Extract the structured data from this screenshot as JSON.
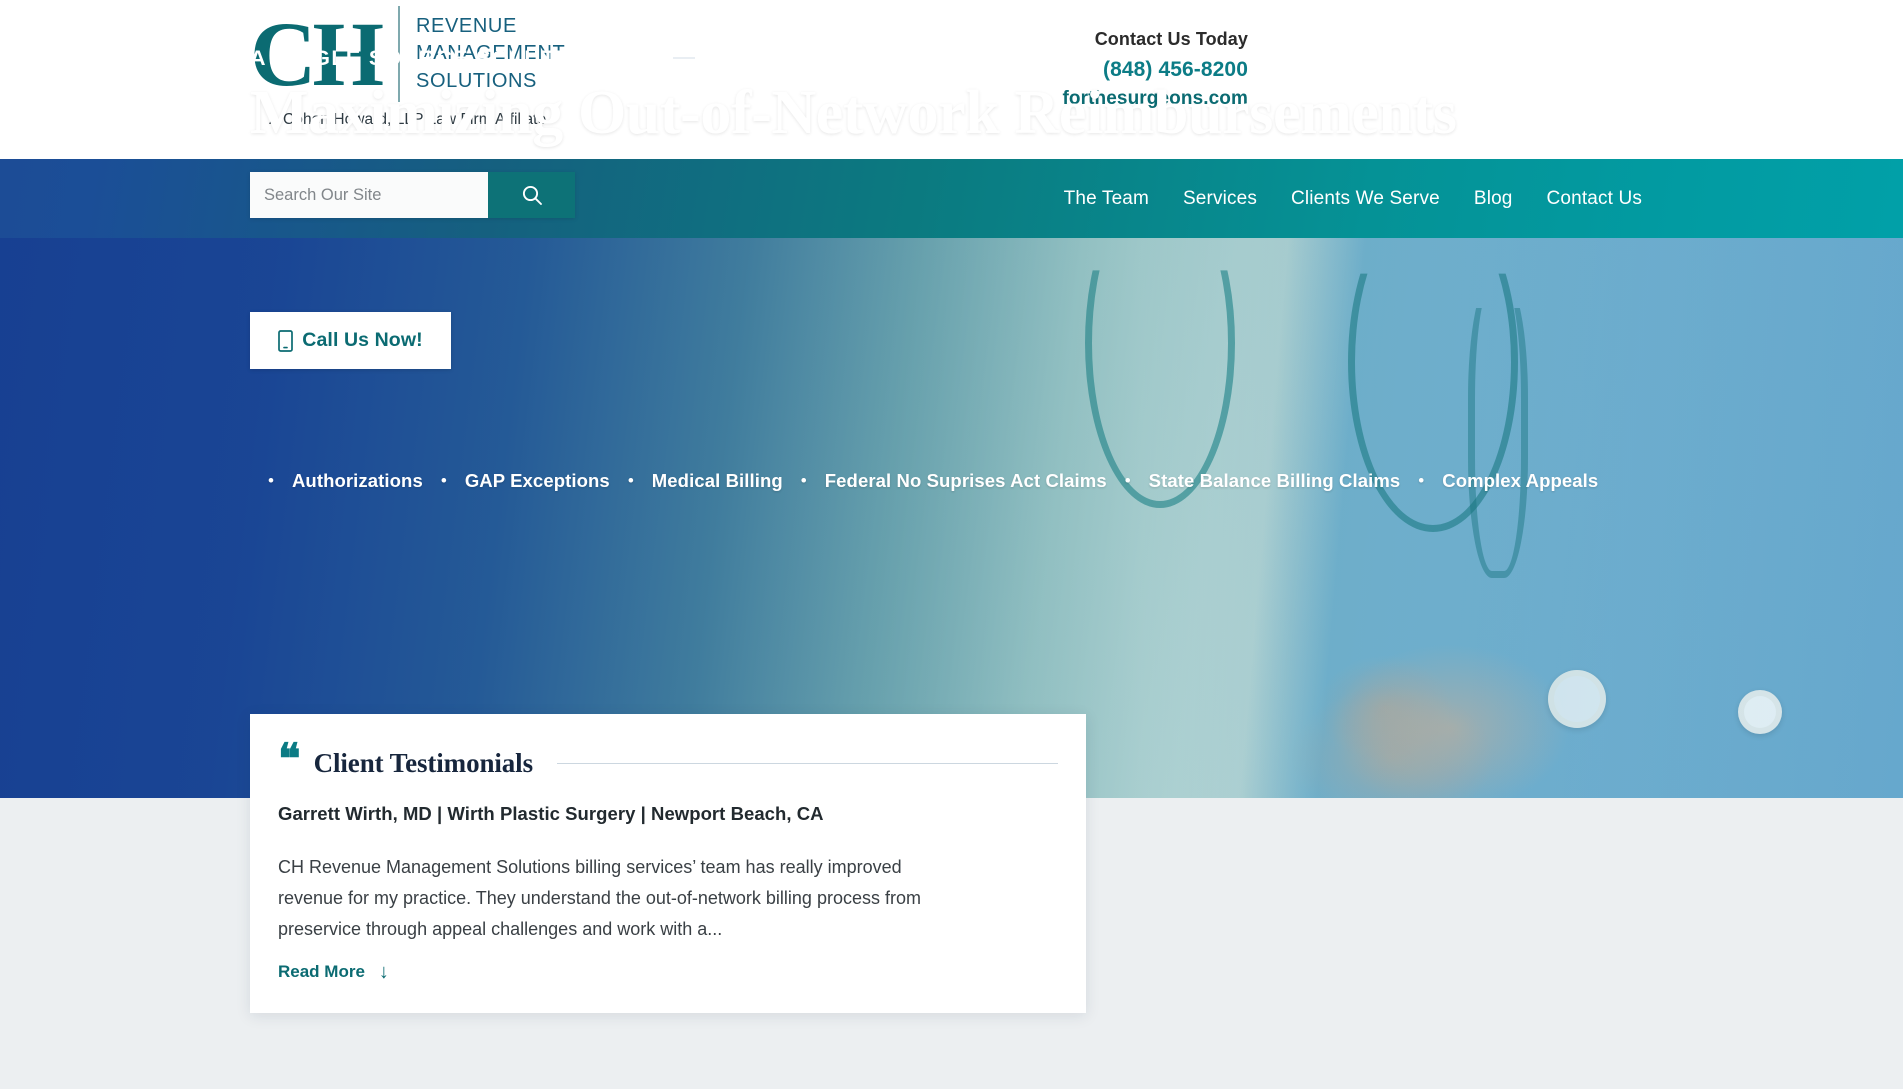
{
  "header": {
    "logo": {
      "monogram": "CH",
      "lines": [
        "REVENUE",
        "MANAGEMENT",
        "SOLUTIONS"
      ],
      "tagline": "A Cohen Howard, LLP Law Firm Affiliate"
    },
    "contact": {
      "title": "Contact Us Today",
      "phone": "(848) 456-8200",
      "website": "forthesurgeons.com"
    }
  },
  "nav": {
    "search": {
      "placeholder": "Search Our Site",
      "value": "",
      "button_icon": "search-icon"
    },
    "links": [
      {
        "label": "The Team"
      },
      {
        "label": "Services"
      },
      {
        "label": "Clients We Serve"
      },
      {
        "label": "Blog"
      },
      {
        "label": "Contact Us"
      }
    ]
  },
  "hero": {
    "eyebrow": "A SINGLE SOURCE SOLUTION FOR",
    "title": "Maximizing Out-of-Network Reimbursements",
    "bullets": [
      "Authorizations",
      "GAP Exceptions",
      "Medical Billing",
      "Federal No Suprises Act Claims",
      "State Balance Billing Claims",
      "Complex Appeals"
    ],
    "bullet_separator": "•",
    "cta": {
      "label": "Call Us Now!",
      "icon": "mobile-phone-icon"
    }
  },
  "testimonial": {
    "quote_icon": "quotation-mark-icon",
    "heading": "Client Testimonials",
    "author": "Garrett Wirth, MD | Wirth Plastic Surgery | Newport Beach, CA",
    "body": "CH Revenue Management Solutions billing services’ team has really improved revenue for my practice.  They understand the out-of-network billing process from preservice through appeal challenges and work with a...",
    "read_more_label": "Read More",
    "read_more_icon": "arrow-down-icon"
  },
  "colors": {
    "brand_teal": "#0b6b72",
    "brand_blue": "#153e91",
    "nav_gradient_start": "#1c4c96",
    "nav_gradient_end": "#01a0a8",
    "lower_section_bg": "#eceff1",
    "card_bg": "#ffffff"
  }
}
